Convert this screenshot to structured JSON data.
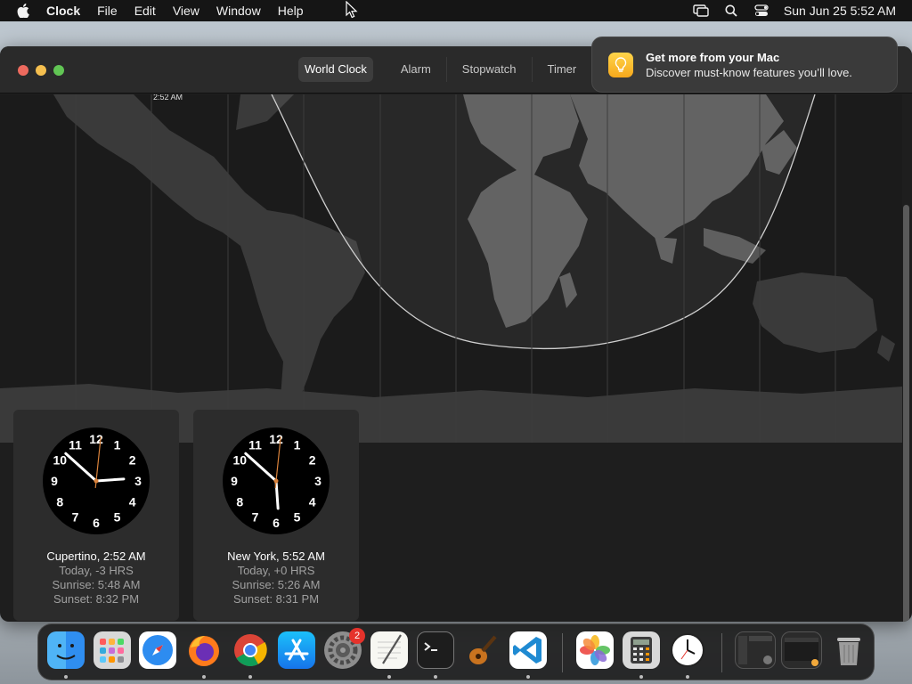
{
  "menubar": {
    "app_name": "Clock",
    "items": [
      "File",
      "Edit",
      "View",
      "Window",
      "Help"
    ],
    "datetime": "Sun Jun 25  5:52 AM"
  },
  "tabs": [
    "World Clock",
    "Alarm",
    "Stopwatch",
    "Timer"
  ],
  "active_tab": "World Clock",
  "map": {
    "time_label": "2:52 AM"
  },
  "clocks": [
    {
      "city_line": "Cupertino, 2:52 AM",
      "offset": "Today, -3 HRS",
      "sunrise": "Sunrise: 5:48 AM",
      "sunset": "Sunset: 8:32 PM",
      "hour": 2,
      "minute": 52,
      "second": 1
    },
    {
      "city_line": "New York, 5:52 AM",
      "offset": "Today, +0 HRS",
      "sunrise": "Sunrise: 5:26 AM",
      "sunset": "Sunset: 8:31 PM",
      "hour": 5,
      "minute": 52,
      "second": 1
    }
  ],
  "clock_numerals": [
    "12",
    "1",
    "2",
    "3",
    "4",
    "5",
    "6",
    "7",
    "8",
    "9",
    "10",
    "11"
  ],
  "notification": {
    "title": "Get more from your Mac",
    "body": "Discover must-know features you’ll love."
  },
  "dock": {
    "items": [
      {
        "name": "finder",
        "running": true
      },
      {
        "name": "launchpad",
        "running": false
      },
      {
        "name": "safari",
        "running": false
      },
      {
        "name": "firefox",
        "running": true
      },
      {
        "name": "chrome",
        "running": true
      },
      {
        "name": "app-store",
        "running": false
      },
      {
        "name": "system-settings",
        "running": false,
        "badge": "2"
      },
      {
        "name": "textedit",
        "running": true
      },
      {
        "name": "terminal",
        "running": true
      },
      {
        "name": "garageband",
        "running": false
      },
      {
        "name": "vscode",
        "running": true
      },
      {
        "name": "photos",
        "running": false
      },
      {
        "name": "calculator",
        "running": true
      },
      {
        "name": "clock",
        "running": true
      },
      {
        "name": "recent-window-1",
        "running": false
      },
      {
        "name": "recent-window-2",
        "running": false
      },
      {
        "name": "trash",
        "running": false
      }
    ]
  },
  "colors": {
    "accent_second_hand": "#d9823b",
    "traffic_close": "#ed6a5e",
    "traffic_minimize": "#f5bf4f",
    "traffic_maximize": "#61c554",
    "badge": "#e5322b"
  }
}
